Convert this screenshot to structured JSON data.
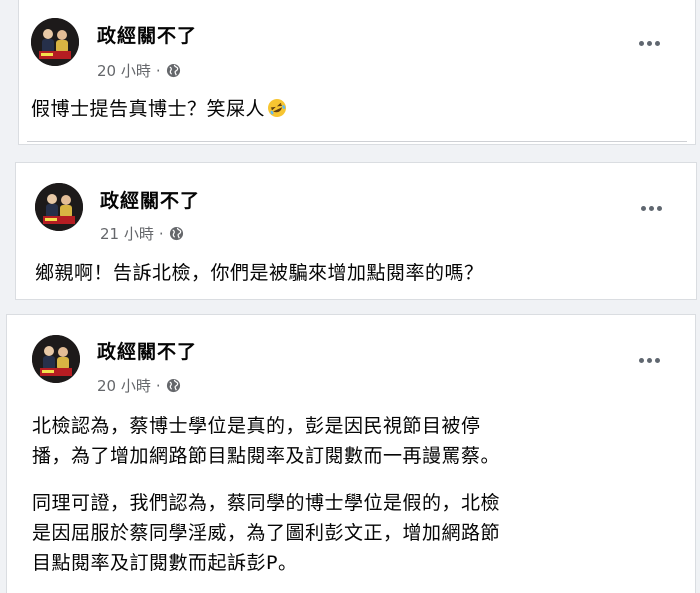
{
  "posts": [
    {
      "author": "政經關不了",
      "time": "20 小時",
      "separator": "·",
      "paragraphs": [
        "假博士提告真博士？笑屎人"
      ],
      "emoji": "rolling-on-floor-laughing"
    },
    {
      "author": "政經關不了",
      "time": "21 小時",
      "separator": "·",
      "paragraphs": [
        "鄉親啊！告訴北檢，你們是被騙來增加點閱率的嗎？"
      ]
    },
    {
      "author": "政經關不了",
      "time": "20 小時",
      "separator": "·",
      "paragraphs": [
        "北檢認為，蔡博士學位是真的，彭是因民視節目被停",
        "播，為了增加網路節目點閱率及訂閱數而一再謾罵蔡。",
        "同理可證，我們認為，蔡同學的博士學位是假的，北檢",
        "是因屈服於蔡同學淫威，為了圖利彭文正，增加網路節",
        "目點閱率及訂閱數而起訴彭P。"
      ]
    }
  ],
  "icons": {
    "privacy": "globe-icon",
    "more": "more-options-icon",
    "emoji": "laughing-emoji-icon"
  },
  "colors": {
    "text": "#050505",
    "secondary": "#65676b",
    "background": "#f0f2f5"
  }
}
